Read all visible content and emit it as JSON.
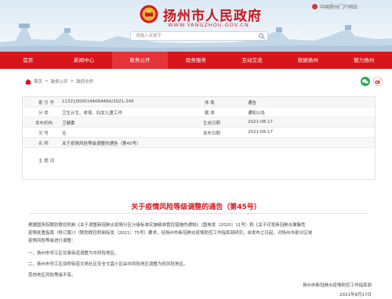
{
  "site": {
    "title": "扬州市人民政府",
    "domain": "WWW.YANGZHOU.GOV.CN",
    "portal_link": "中国扬州门户网站",
    "search_placeholder": "请输入关键字"
  },
  "nav": [
    {
      "label": "首页"
    },
    {
      "label": "新闻中心"
    },
    {
      "label": "政务公开"
    },
    {
      "label": "政务服务"
    },
    {
      "label": "互动交流"
    },
    {
      "label": "数据扬州"
    },
    {
      "label": "魅力扬州"
    }
  ],
  "breadcrumb": [
    "首页",
    "政务公开",
    "政府文件"
  ],
  "meta": {
    "index_label": "索 引 号",
    "index_value": "11321000014406449X/2021-245",
    "category_label": "分 类",
    "category_value": "卫生计生、体育、妇女儿童工作",
    "publisher_label": "发布机构",
    "publisher_value": "卫健委",
    "docno_label": "文 号",
    "docno_value": "无",
    "name_label": "名 称",
    "name_value": "关于疫情风险等级调整的通告（第45号）",
    "keywords_label": "主 题 词",
    "keywords_value": "",
    "genre_label": "体 裁",
    "genre_value": "通告",
    "carrier_label": "载 体",
    "carrier_value": "通知公告",
    "created_label": "生成日期",
    "created_value": "2021-08-17",
    "published_label": "发布日期",
    "published_value": "2021-08-17"
  },
  "article": {
    "title": "关于疫情风险等级调整的通告（第45号）",
    "p1_l1": "根据国务院联防联控机制《关于调整新冠肺炎疫情分区分级标准实施精准管控措施的通知》（国电发〔2020〕11号）和《关于印发新冠肺炎聚集性",
    "p1_l2": "疫情处置指南（修订版）》（联防联控机制综发〔2021〕75号）要求，经扬州市新冠肺炎疫情防控工作指挥部研究，自发布之日起，对扬州市部分区域",
    "p1_l3": "疫情风险等级进行调整：",
    "item1": "一、扬州市邗江区甘泉街道调整为中风险地区。",
    "item2": "二、扬州市邗江区双桥街道文扬社区安全文昌小区由中风险地区调整为低风险地区。",
    "p2": "其他地区风险等级不变。",
    "signature": "扬州市新冠肺炎疫情防控工作指挥部",
    "date": "2021年8月17日"
  },
  "colors": {
    "brand_red": "#d7161c",
    "title_red": "#c8161d"
  }
}
